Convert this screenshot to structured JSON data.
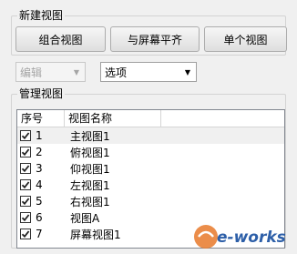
{
  "new_view": {
    "title": "新建视图",
    "buttons": [
      "组合视图",
      "与屏幕平齐",
      "单个视图"
    ]
  },
  "edit_combo": {
    "value": "编辑"
  },
  "options_combo": {
    "value": "选项"
  },
  "manage": {
    "title": "管理视图",
    "columns": [
      "序号",
      "视图名称"
    ],
    "rows": [
      {
        "num": "1",
        "name": "主视图1",
        "checked": true
      },
      {
        "num": "2",
        "name": "俯视图1",
        "checked": true
      },
      {
        "num": "3",
        "name": "仰视图1",
        "checked": true
      },
      {
        "num": "4",
        "name": "左视图1",
        "checked": true
      },
      {
        "num": "5",
        "name": "右视图1",
        "checked": true
      },
      {
        "num": "6",
        "name": "视图A",
        "checked": true
      },
      {
        "num": "7",
        "name": "屏幕视图1",
        "checked": true
      }
    ]
  },
  "watermark": {
    "text": "e-works"
  }
}
